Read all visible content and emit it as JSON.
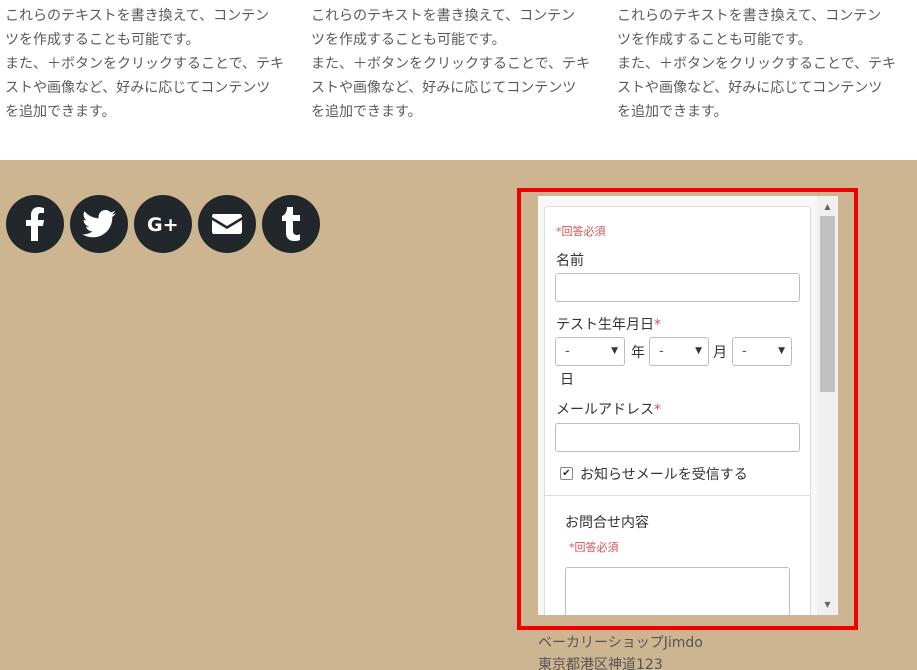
{
  "intro_columns": [
    {
      "line1": "これらのテキストを書き換えて、コンテン",
      "line2": "ツを作成することも可能です。",
      "line3": "また、＋ボタンをクリックすることで、テキ",
      "line4": "ストや画像など、好みに応じてコンテンツ",
      "line5": "を追加できます。"
    },
    {
      "line1": "これらのテキストを書き換えて、コンテン",
      "line2": "ツを作成することも可能です。",
      "line3": "また、＋ボタンをクリックすることで、テキ",
      "line4": "ストや画像など、好みに応じてコンテンツ",
      "line5": "を追加できます。"
    },
    {
      "line1": "これらのテキストを書き換えて、コンテン",
      "line2": "ツを作成することも可能です。",
      "line3": "また、＋ボタンをクリックすることで、テキ",
      "line4": "ストや画像など、好みに応じてコンテンツ",
      "line5": "を追加できます。"
    }
  ],
  "social": [
    {
      "icon": "facebook-icon"
    },
    {
      "icon": "twitter-icon"
    },
    {
      "icon": "google-plus-icon"
    },
    {
      "icon": "mail-icon"
    },
    {
      "icon": "tumblr-icon"
    }
  ],
  "form": {
    "required_note": "*回答必須",
    "name_label": "名前",
    "name_value": "",
    "birthdate_label": "テスト生年月日",
    "required_star": "*",
    "year_select": "-",
    "year_suffix": "年",
    "month_select": "-",
    "month_suffix": "月",
    "day_select": "-",
    "day_suffix": "日",
    "email_label": "メールアドレス",
    "email_value": "",
    "newsletter_label": "お知らせメールを受信する",
    "newsletter_checked": true,
    "inquiry_label": "お問合せ内容",
    "inquiry_required_note": "*回答必須",
    "inquiry_value": ""
  },
  "address": {
    "line1": "ベーカリーショップJimdo",
    "line2": "東京都港区神道123"
  },
  "colors": {
    "footer_bg": "#cdb592",
    "social_bg": "#22272c",
    "highlight": "#ee0000",
    "required": "#d9534f"
  }
}
